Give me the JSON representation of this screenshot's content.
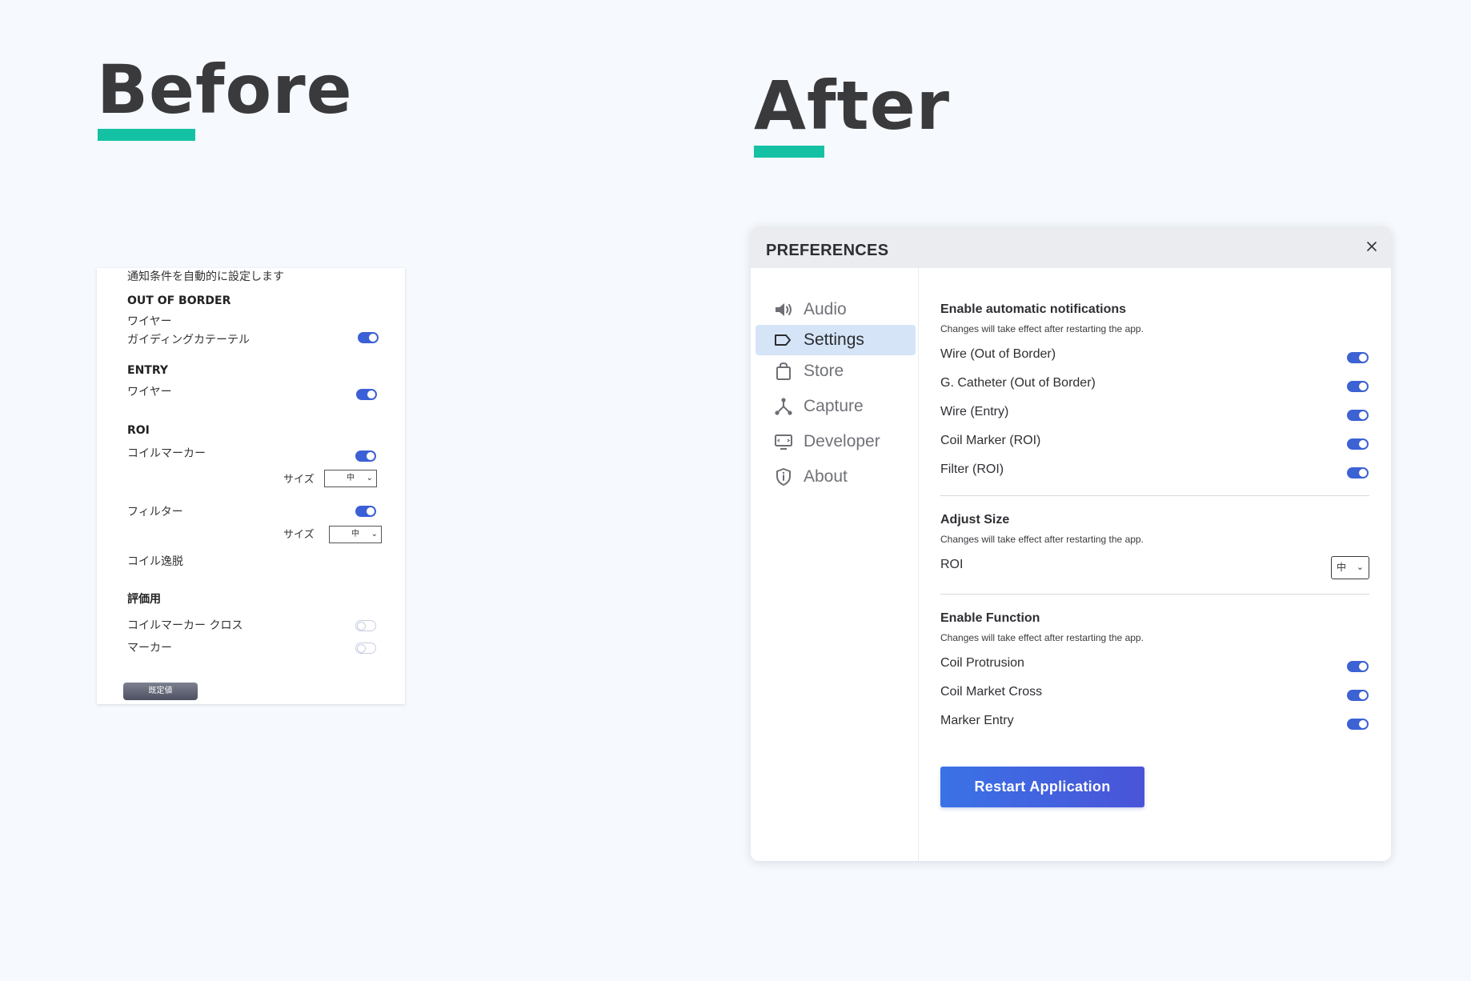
{
  "before": {
    "heading": "Before",
    "intro": "通知条件を自動的に設定します",
    "out_of_border": {
      "title": "OUT OF BORDER",
      "wire": "ワイヤー",
      "catheter": "ガイディングカテーテル"
    },
    "entry": {
      "title": "ENTRY",
      "wire": "ワイヤー"
    },
    "roi": {
      "title": "ROI",
      "coil_marker": "コイルマーカー",
      "size_label_1": "サイズ",
      "size_value_1": "中",
      "filter": "フィルター",
      "size_label_2": "サイズ",
      "size_value_2": "中",
      "coil_escape": "コイル逸脱"
    },
    "evaluation": {
      "title": "評価用",
      "coil_marker_cross": "コイルマーカー クロス",
      "marker": "マーカー"
    },
    "default_button": "既定値",
    "toggle_states": {
      "catheter": true,
      "entry_wire": true,
      "coil_marker": true,
      "filter": true,
      "coil_marker_cross": false,
      "marker": false
    }
  },
  "after": {
    "heading": "After",
    "window_title": "PREFERENCES",
    "sidebar": [
      {
        "label": "Audio",
        "icon": "speaker-icon",
        "active": false
      },
      {
        "label": "Settings",
        "icon": "tag-icon",
        "active": true
      },
      {
        "label": "Store",
        "icon": "shopping-bag-icon",
        "active": false
      },
      {
        "label": "Capture",
        "icon": "share-node-icon",
        "active": false
      },
      {
        "label": "Developer",
        "icon": "monitor-icon",
        "active": false
      },
      {
        "label": "About",
        "icon": "shield-info-icon",
        "active": false
      }
    ],
    "notifications": {
      "title": "Enable automatic notifications",
      "subtitle": "Changes will take effect after restarting the app.",
      "items": [
        {
          "label": "Wire (Out of Border)",
          "on": true
        },
        {
          "label": "G. Catheter (Out of Border)",
          "on": true
        },
        {
          "label": "Wire (Entry)",
          "on": true
        },
        {
          "label": "Coil Marker (ROI)",
          "on": true
        },
        {
          "label": "Filter (ROI)",
          "on": true
        }
      ]
    },
    "adjust_size": {
      "title": "Adjust Size",
      "subtitle": "Changes will take effect after restarting the app.",
      "roi_label": "ROI",
      "roi_value": "中"
    },
    "functions": {
      "title": "Enable Function",
      "subtitle": "Changes will take effect after restarting the app.",
      "items": [
        {
          "label": "Coil Protrusion",
          "on": true
        },
        {
          "label": "Coil Market Cross",
          "on": true
        },
        {
          "label": "Marker Entry",
          "on": true
        }
      ]
    },
    "restart_button": "Restart Application"
  },
  "colors": {
    "accent_bar": "#14c2a3",
    "toggle_on": "#3c62d4",
    "active_nav": "#d5e5f7",
    "button_start": "#3a72e6",
    "button_end": "#4a54d8"
  }
}
